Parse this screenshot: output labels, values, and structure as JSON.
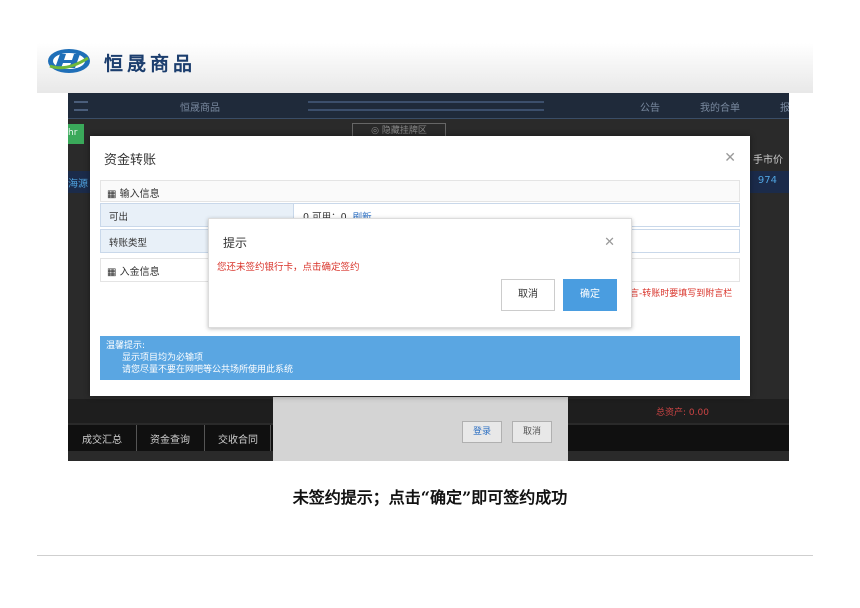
{
  "brand": {
    "name": "恒晟商品"
  },
  "app": {
    "nav_title": "恒晟商品",
    "nav_items": [
      "公告",
      "我的合单",
      "报"
    ],
    "green_tab": "hr",
    "hide_button": "◎  隐藏挂牌区",
    "side_label": "手市价",
    "row_left": "海源",
    "row_right": "974",
    "total_assets": "总资产: 0.00",
    "bottom_tabs": [
      "成交汇总",
      "资金查询",
      "交收合同"
    ],
    "bg_buttons": {
      "login": "登录",
      "cancel": "取消"
    }
  },
  "dialog": {
    "title": "资金转账",
    "section_input": "输入信息",
    "fields": [
      {
        "label": "可出",
        "value": "0   可用：0",
        "link": "刷新"
      },
      {
        "label": "转账类型",
        "value": ""
      }
    ],
    "section_deposit": "入金信息",
    "note": "言-转账时要填写到附言栏",
    "tips": {
      "heading": "温馨提示:",
      "lines": [
        "显示项目均为必输项",
        "请您尽量不要在网吧等公共场所使用此系统"
      ]
    }
  },
  "alert": {
    "title": "提示",
    "message": "您还未签约银行卡，点击确定签约",
    "cancel_label": "取消",
    "ok_label": "确定"
  },
  "caption": "未签约提示；点击“确定”即可签约成功",
  "colors": {
    "accent": "#4a9de0",
    "warning": "#d9342b",
    "brand": "#1c3e6e"
  }
}
